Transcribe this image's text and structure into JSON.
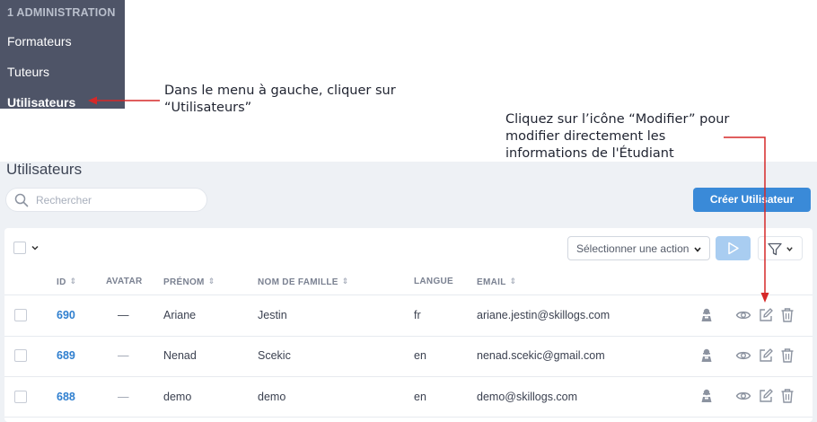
{
  "sidebar": {
    "section_title": "1 ADMINISTRATION",
    "items": [
      {
        "label": "Formateurs"
      },
      {
        "label": "Tuteurs"
      },
      {
        "label": "Utilisateurs"
      }
    ]
  },
  "annotations": {
    "menu_note_line1": "Dans le menu à gauche, cliquer sur",
    "menu_note_line2": "“Utilisateurs”",
    "edit_note_line1": "Cliquez sur l’icône “Modifier” pour",
    "edit_note_line2": "modifier directement les",
    "edit_note_line3": "informations de l'Étudiant"
  },
  "page": {
    "title": "Utilisateurs",
    "search_placeholder": "Rechercher",
    "create_button": "Créer Utilisateur",
    "action_select": "Sélectionner une action"
  },
  "table": {
    "columns": [
      "ID",
      "AVATAR",
      "PRÉNOM",
      "NOM DE FAMILLE",
      "LANGUE",
      "EMAIL"
    ],
    "rows": [
      {
        "id": "690",
        "avatar": "—",
        "prenom": "Ariane",
        "nom": "Jestin",
        "langue": "fr",
        "email": "ariane.jestin@skillogs.com"
      },
      {
        "id": "689",
        "avatar": "—",
        "prenom": "Nenad",
        "nom": "Scekic",
        "langue": "en",
        "email": "nenad.scekic@gmail.com"
      },
      {
        "id": "688",
        "avatar": "—",
        "prenom": "demo",
        "nom": "demo",
        "langue": "en",
        "email": "demo@skillogs.com"
      }
    ]
  },
  "icons": {
    "row_actions": [
      "impersonate-icon",
      "view-icon",
      "edit-icon",
      "delete-icon"
    ],
    "annotation_arrow_color": "#d62828",
    "accent": "#3a8ad8"
  }
}
